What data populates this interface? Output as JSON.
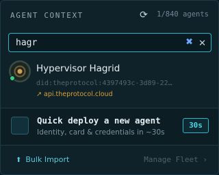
{
  "header": {
    "title": "AGENT CONTEXT",
    "refresh_icon": "refresh-icon",
    "agent_count": "1/840 agents"
  },
  "search": {
    "value": "hagr",
    "clear_icon": "clear-search-icon",
    "close_icon": "close-icon"
  },
  "results": [
    {
      "name": "Hypervisor Hagrid",
      "did": "did:theprotocol:4397493c-3d89-22…",
      "host": "api.theprotocol.cloud",
      "host_icon": "external-link-icon",
      "status": "online"
    }
  ],
  "quick_deploy": {
    "title": "Quick deploy a new agent",
    "subtitle": "Identity, card & credentials in ~30s",
    "badge": "30s"
  },
  "footer": {
    "bulk_import_label": "Bulk Import",
    "bulk_import_icon": "upload-icon",
    "manage_fleet_label": "Manage Fleet ›"
  },
  "colors": {
    "accent": "#2bb7c9",
    "background": "#0f2129",
    "status_online": "#35d07f",
    "host_link": "#d6a03c"
  }
}
